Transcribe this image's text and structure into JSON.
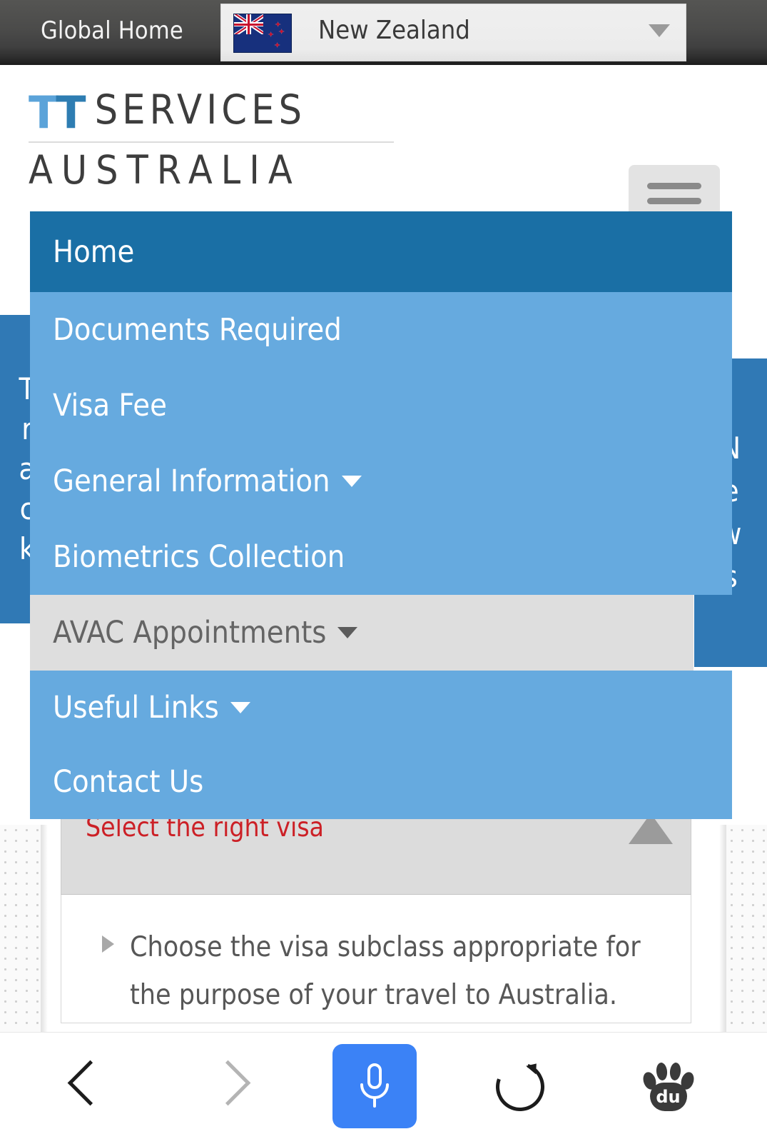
{
  "topbar": {
    "global_home_label": "Global Home",
    "country_selected": "New Zealand",
    "flag_icon": "new-zealand-flag-icon",
    "dropdown_caret": "chevron-down-icon"
  },
  "header": {
    "logo": {
      "t1": "T",
      "t2": "T",
      "services": "SERVICES",
      "australia": "AUSTRALIA",
      "t1_color": "#5ba3d9",
      "t2_color": "#2e7db2",
      "text_color": "#3d3d3d"
    },
    "menu_toggle_icon": "hamburger-menu-icon"
  },
  "side_tabs": {
    "track": [
      "T",
      "r",
      "a",
      "c",
      "k"
    ],
    "news": [
      "N",
      "e",
      "w",
      "s"
    ],
    "track_label": "Track",
    "news_label": "News",
    "background_color": "#3079b5"
  },
  "nav": {
    "colors": {
      "active_bg": "#1a6fa5",
      "item_bg": "#66aadf",
      "hover_bg": "#dedede",
      "hover_text": "#646464"
    },
    "items": [
      {
        "label": "Home",
        "state": "active",
        "caret": false
      },
      {
        "label": "Documents Required",
        "state": "default",
        "caret": false
      },
      {
        "label": "Visa Fee",
        "state": "default",
        "caret": false
      },
      {
        "label": "General Information",
        "state": "default",
        "caret": true
      },
      {
        "label": "Biometrics Collection",
        "state": "default",
        "caret": false
      },
      {
        "label": "AVAC Appointments",
        "state": "hover",
        "caret": true
      },
      {
        "label": "Useful Links",
        "state": "default",
        "caret": true
      },
      {
        "label": "Contact Us",
        "state": "default",
        "caret": false
      }
    ]
  },
  "content": {
    "accordion_title": "Select the right visa",
    "accordion_title_color": "#cc2026",
    "collapse_icon": "triangle-up-icon",
    "bullet_icon": "triangle-right-bullet-icon",
    "bullet_text": "Choose the visa subclass appropriate for the purpose of your travel to Australia."
  },
  "bottombar": {
    "back_icon": "chevron-left-icon",
    "forward_icon": "chevron-right-icon",
    "mic_icon": "microphone-icon",
    "reload_icon": "reload-icon",
    "baidu_icon": "baidu-paw-logo",
    "baidu_text": "du",
    "mic_button_color": "#3b82f6"
  }
}
